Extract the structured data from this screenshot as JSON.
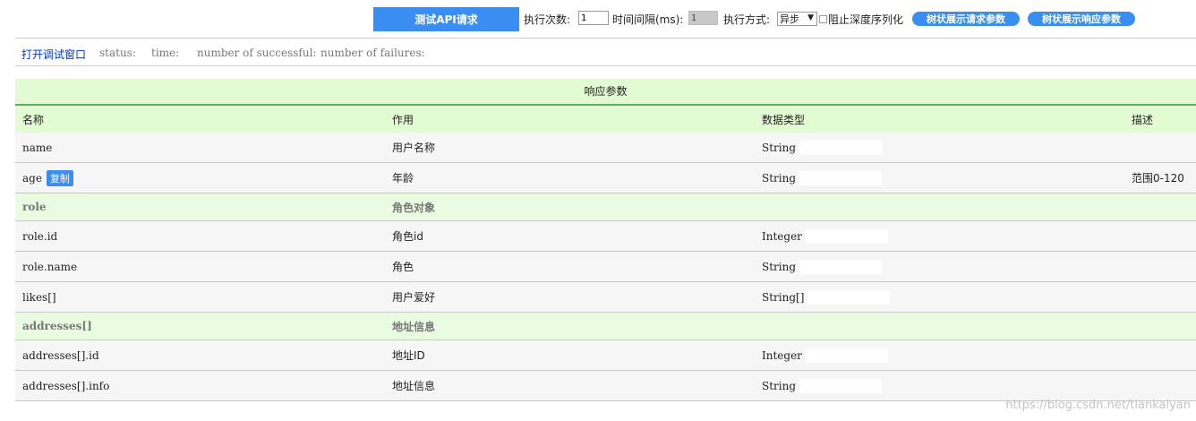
{
  "toolbar": {
    "test_button": "测试API请求",
    "exec_count_label": "执行次数:",
    "exec_count_value": "1",
    "interval_label": "时间间隔(ms):",
    "interval_value": "1",
    "exec_mode_label": "执行方式:",
    "exec_mode_value": "异步",
    "block_serialize_label": "阻止深度序列化",
    "tree_request_button": "树状展示请求参数",
    "tree_response_button": "树状展示响应参数"
  },
  "status_bar": {
    "open_debug_link": "打开调试窗口",
    "status_label": "status:",
    "time_label": "time:",
    "successful_label": "number of successful:",
    "failures_label": "number of failures:"
  },
  "response_table": {
    "caption": "响应参数",
    "headers": [
      "名称",
      "作用",
      "数据类型",
      "描述"
    ],
    "copy_label": "复制",
    "rows": [
      {
        "kind": "data",
        "name": "name",
        "purpose": "用户名称",
        "type": "String",
        "desc": ""
      },
      {
        "kind": "data",
        "name": "age",
        "purpose": "年龄",
        "type": "String",
        "desc": "范围0-120",
        "copy": true
      },
      {
        "kind": "group",
        "name": "role",
        "purpose": "角色对象"
      },
      {
        "kind": "data",
        "name": "role.id",
        "purpose": "角色id",
        "type": "Integer",
        "desc": ""
      },
      {
        "kind": "data",
        "name": "role.name",
        "purpose": "角色",
        "type": "String",
        "desc": ""
      },
      {
        "kind": "data",
        "name": "likes[]",
        "purpose": "用户爱好",
        "type": "String[]",
        "desc": ""
      },
      {
        "kind": "group",
        "name": "addresses[]",
        "purpose": "地址信息"
      },
      {
        "kind": "data",
        "name": "addresses[].id",
        "purpose": "地址ID",
        "type": "Integer",
        "desc": ""
      },
      {
        "kind": "data",
        "name": "addresses[].info",
        "purpose": "地址信息",
        "type": "String",
        "desc": ""
      }
    ]
  },
  "watermark": "https://blog.csdn.net/tiankaiyan",
  "colors": {
    "accent_blue": "#3a8ef2",
    "header_green": "#e2fbd3",
    "group_green": "#e9fbe0",
    "link_blue": "#0033cc"
  }
}
